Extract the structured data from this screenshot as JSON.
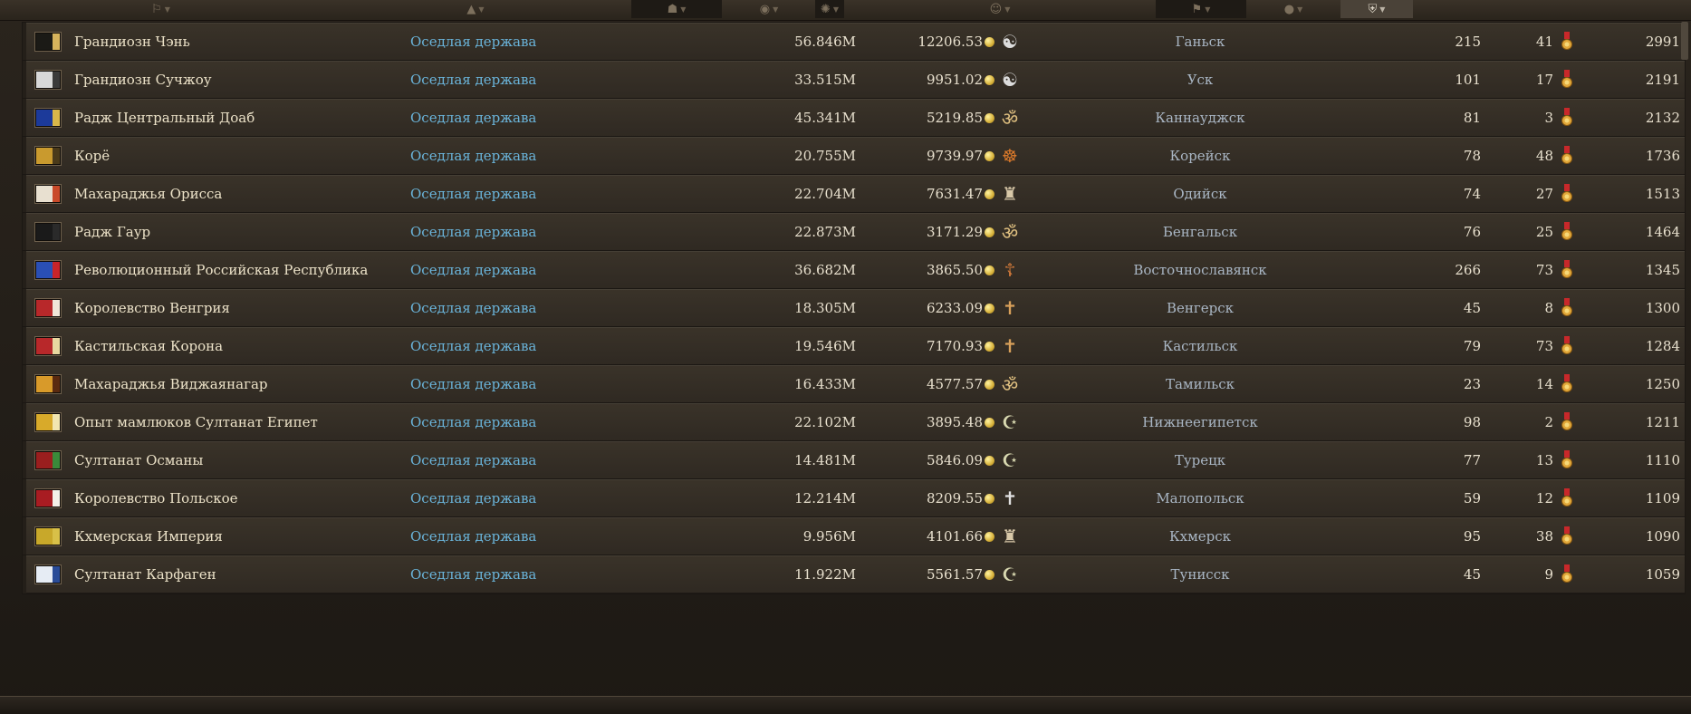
{
  "header": {
    "columns": [
      {
        "icon": "flag-icon"
      },
      {
        "icon": "government-icon"
      },
      {
        "icon": "population-icon"
      },
      {
        "icon": "money-icon"
      },
      {
        "icon": "religion-icon"
      },
      {
        "icon": "culture-icon"
      },
      {
        "icon": "states-icon"
      },
      {
        "icon": "army-icon"
      },
      {
        "icon": "score-icon"
      }
    ]
  },
  "rows": [
    {
      "name": "Грандиозн Чэнь",
      "government": "Оседлая держава",
      "population": "56.846M",
      "money": "12206.53",
      "religion": "yin-yang",
      "culture": "Ганьск",
      "states": "215",
      "army": "41",
      "score": "2991",
      "flag": {
        "bg": "#1b1a16",
        "accent": "#d6b35c"
      }
    },
    {
      "name": "Грандиозн Сучжоу",
      "government": "Оседлая держава",
      "population": "33.515M",
      "money": "9951.02",
      "religion": "yin-yang",
      "culture": "Уск",
      "states": "101",
      "army": "17",
      "score": "2191",
      "flag": {
        "bg": "#d8d8d8",
        "accent": "#3a3a3a"
      }
    },
    {
      "name": "Радж Центральный Доаб",
      "government": "Оседлая держава",
      "population": "45.341M",
      "money": "5219.85",
      "religion": "om",
      "culture": "Каннауджск",
      "states": "81",
      "army": "3",
      "score": "2132",
      "flag": {
        "bg": "#1c3a9a",
        "accent": "#d8b74a"
      }
    },
    {
      "name": "Корё",
      "government": "Оседлая держава",
      "population": "20.755M",
      "money": "9739.97",
      "religion": "dharma",
      "culture": "Корейск",
      "states": "78",
      "army": "48",
      "score": "1736",
      "flag": {
        "bg": "#c99a2e",
        "accent": "#4a3a1a"
      }
    },
    {
      "name": "Махараджья Орисса",
      "government": "Оседлая держава",
      "population": "22.704M",
      "money": "7631.47",
      "religion": "stupa",
      "culture": "Одийск",
      "states": "74",
      "army": "27",
      "score": "1513",
      "flag": {
        "bg": "#e8e0d0",
        "accent": "#c94a2a"
      }
    },
    {
      "name": "Радж Гаур",
      "government": "Оседлая держава",
      "population": "22.873M",
      "money": "3171.29",
      "religion": "om",
      "culture": "Бенгальск",
      "states": "76",
      "army": "25",
      "score": "1464",
      "flag": {
        "bg": "#1a1a1a",
        "accent": "#2a2a2a"
      }
    },
    {
      "name": "Революционный Российская Республика",
      "government": "Оседлая держава",
      "population": "36.682M",
      "money": "3865.50",
      "religion": "orthodox-cross",
      "culture": "Восточнославянск",
      "states": "266",
      "army": "73",
      "score": "1345",
      "flag": {
        "bg": "#2a4fb5",
        "accent": "#c8242a"
      }
    },
    {
      "name": "Королевство Венгрия",
      "government": "Оседлая держава",
      "population": "18.305M",
      "money": "6233.09",
      "religion": "catholic-cross",
      "culture": "Венгерск",
      "states": "45",
      "army": "8",
      "score": "1300",
      "flag": {
        "bg": "#b8282a",
        "accent": "#f0e6d8"
      }
    },
    {
      "name": "Кастильская Корона",
      "government": "Оседлая держава",
      "population": "19.546M",
      "money": "7170.93",
      "religion": "catholic-cross",
      "culture": "Кастильск",
      "states": "79",
      "army": "73",
      "score": "1284",
      "flag": {
        "bg": "#b8282a",
        "accent": "#e8d8a0"
      }
    },
    {
      "name": "Махараджья Виджаянагар",
      "government": "Оседлая держава",
      "population": "16.433M",
      "money": "4577.57",
      "religion": "om",
      "culture": "Тамильск",
      "states": "23",
      "army": "14",
      "score": "1250",
      "flag": {
        "bg": "#d89a2a",
        "accent": "#5a2a10"
      }
    },
    {
      "name": "Опыт мамлюков Султанат Египет",
      "government": "Оседлая держава",
      "population": "22.102M",
      "money": "3895.48",
      "religion": "crescent",
      "culture": "Нижнеегипетск",
      "states": "98",
      "army": "2",
      "score": "1211",
      "flag": {
        "bg": "#d8aa2a",
        "accent": "#f2e6b0"
      }
    },
    {
      "name": "Султанат Османы",
      "government": "Оседлая держава",
      "population": "14.481M",
      "money": "5846.09",
      "religion": "crescent",
      "culture": "Турецк",
      "states": "77",
      "army": "13",
      "score": "1110",
      "flag": {
        "bg": "#9a1e1e",
        "accent": "#3a8a3a"
      }
    },
    {
      "name": "Королевство Польское",
      "government": "Оседлая держава",
      "population": "12.214M",
      "money": "8209.55",
      "religion": "latin-cross",
      "culture": "Малопольск",
      "states": "59",
      "army": "12",
      "score": "1109",
      "flag": {
        "bg": "#a81c22",
        "accent": "#f4f0e8"
      }
    },
    {
      "name": "Кхмерская Империя",
      "government": "Оседлая держава",
      "population": "9.956M",
      "money": "4101.66",
      "religion": "stupa",
      "culture": "Кхмерск",
      "states": "95",
      "army": "38",
      "score": "1090",
      "flag": {
        "bg": "#c8a82a",
        "accent": "#d8c048"
      }
    },
    {
      "name": "Султанат Карфаген",
      "government": "Оседлая держава",
      "population": "11.922M",
      "money": "5561.57",
      "religion": "crescent",
      "culture": "Тунисск",
      "states": "45",
      "army": "9",
      "score": "1059",
      "flag": {
        "bg": "#e6ecf4",
        "accent": "#2a4c98"
      }
    }
  ],
  "colors": {
    "row_bg": "#332d25",
    "name": "#ece2c8",
    "government": "#6ab4da",
    "culture": "#a9b6c4",
    "numbers": "#e8e0ce"
  }
}
